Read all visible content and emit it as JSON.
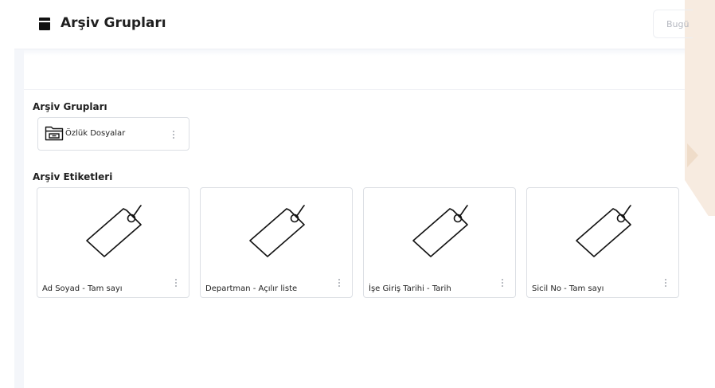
{
  "header": {
    "title": "Arşiv Grupları",
    "today_button": "Bugü"
  },
  "sections": {
    "groups_title": "Arşiv Grupları",
    "tags_title": "Arşiv Etiketleri"
  },
  "groups": [
    {
      "label": "Özlük Dosyalar",
      "icon": "folder-archive-icon"
    }
  ],
  "tags": [
    {
      "label": "Ad Soyad - Tam sayı",
      "icon": "tag-icon"
    },
    {
      "label": "Departman - Açılır liste",
      "icon": "tag-icon"
    },
    {
      "label": "İşe Giriş Tarihi - Tarih",
      "icon": "tag-icon"
    },
    {
      "label": "Sicil No - Tam sayı",
      "icon": "tag-icon"
    }
  ],
  "colors": {
    "accent_bg": "#f7ebe0",
    "border": "#dcdfe4",
    "text": "#1f1f1f"
  }
}
